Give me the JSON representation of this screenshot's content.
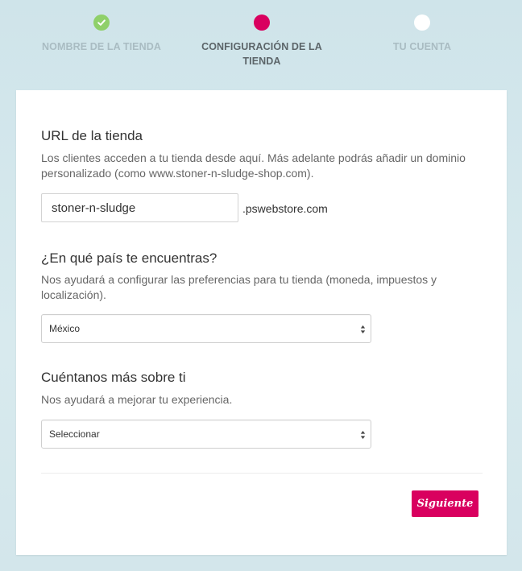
{
  "stepper": {
    "steps": [
      {
        "label": "NOMBRE DE LA TIENDA",
        "state": "done"
      },
      {
        "label": "CONFIGURACIÓN DE LA TIENDA",
        "state": "active"
      },
      {
        "label": "TU CUENTA",
        "state": "todo"
      }
    ]
  },
  "form": {
    "url_section": {
      "title": "URL de la tienda",
      "description": "Los clientes acceden a tu tienda desde aquí. Más adelante podrás añadir un dominio personalizado (como www.stoner-n-sludge-shop.com).",
      "input_value": "stoner-n-sludge",
      "suffix": ".pswebstore.com"
    },
    "country_section": {
      "title": "¿En qué país te encuentras?",
      "description": "Nos ayudará a configurar las preferencias para tu tienda (moneda, impuestos y localización).",
      "selected": "México"
    },
    "about_section": {
      "title": "Cuéntanos más sobre ti",
      "description": "Nos ayudará a mejorar tu experiencia.",
      "selected": "Seleccionar"
    },
    "next_label": "Siguiente"
  },
  "colors": {
    "accent": "#d9005f",
    "done": "#8fd06a",
    "background": "#d3e6eb"
  }
}
